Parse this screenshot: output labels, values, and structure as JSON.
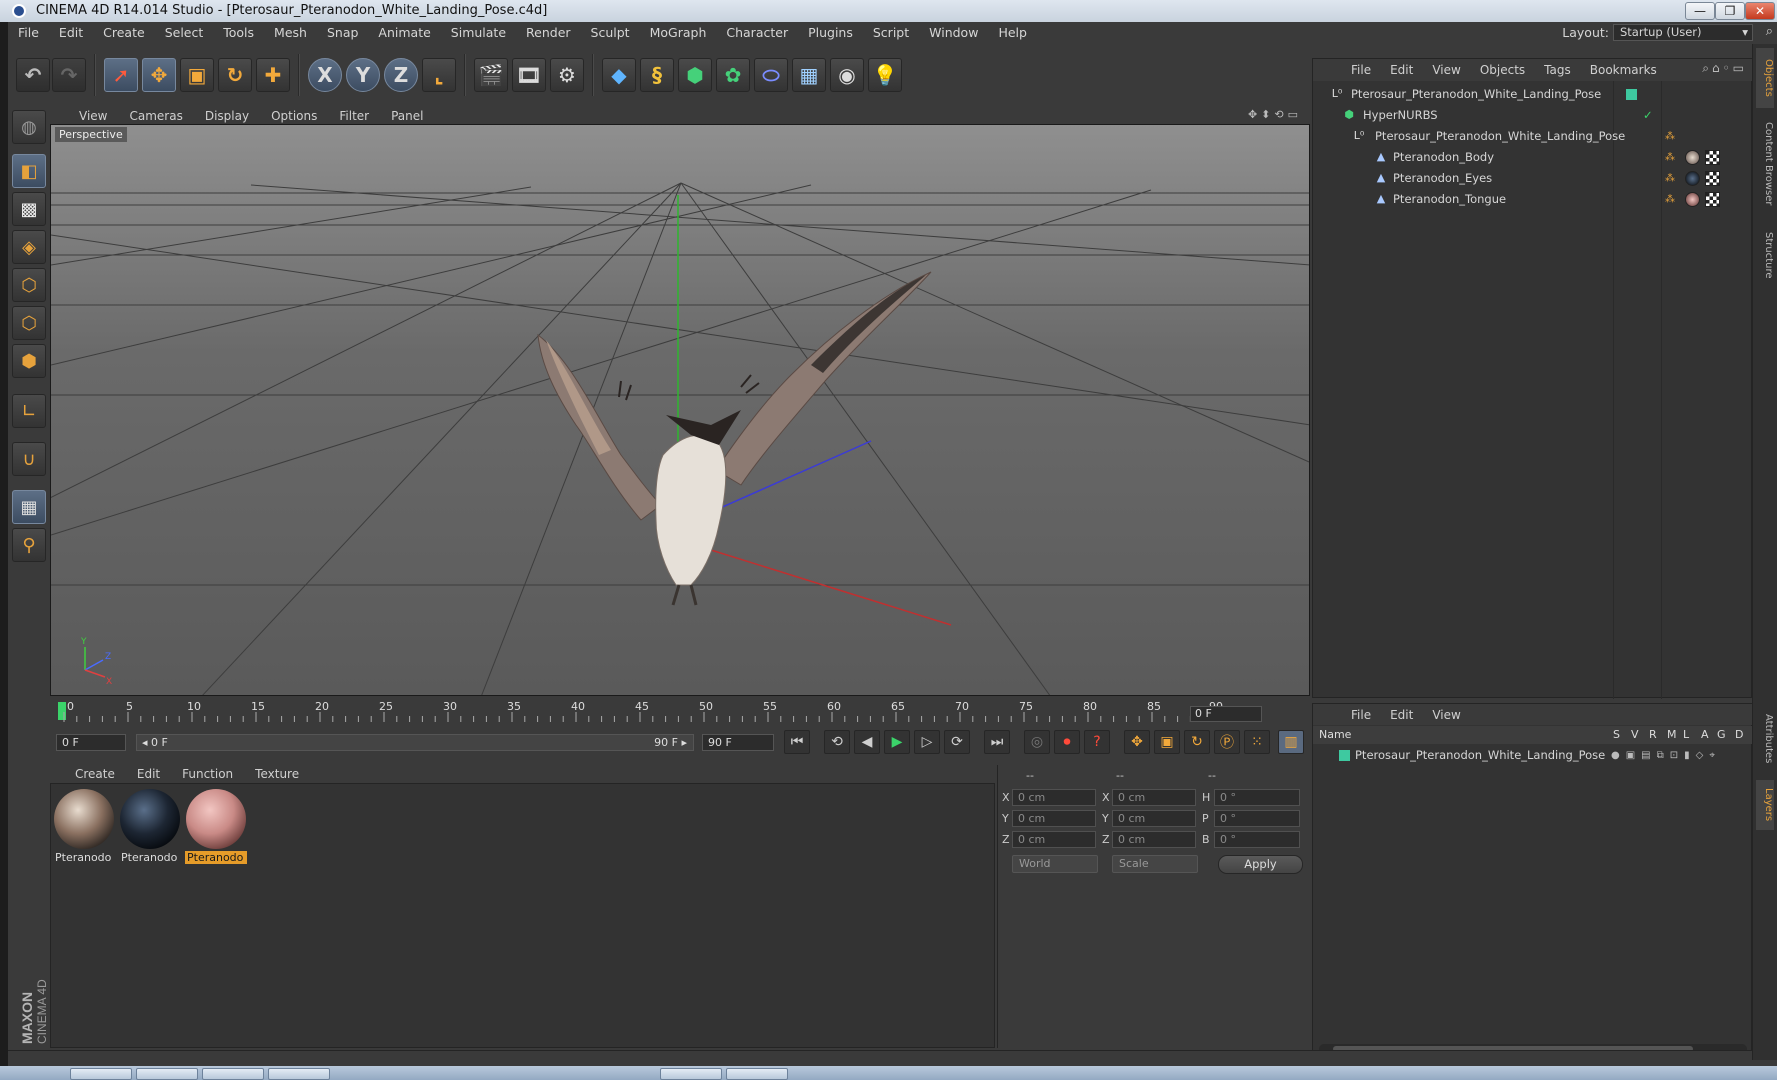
{
  "window": {
    "title": "CINEMA 4D R14.014 Studio - [Pterosaur_Pteranodon_White_Landing_Pose.c4d]",
    "controls": [
      "minimize-icon",
      "restore-icon",
      "close-icon"
    ]
  },
  "menubar": {
    "items": [
      "File",
      "Edit",
      "Create",
      "Select",
      "Tools",
      "Mesh",
      "Snap",
      "Animate",
      "Simulate",
      "Render",
      "Sculpt",
      "MoGraph",
      "Character",
      "Plugins",
      "Script",
      "Window",
      "Help"
    ],
    "layout_label": "Layout:",
    "layout_value": "Startup (User)"
  },
  "toolbar": {
    "icons": [
      "undo-icon",
      "redo-icon",
      "live-selection-icon",
      "move-icon",
      "scale-icon",
      "rotate-icon",
      "transform-icon",
      "x-axis-lock-icon",
      "y-axis-lock-icon",
      "z-axis-lock-icon",
      "coordinate-system-icon",
      "render-view-icon",
      "render-picture-viewer-icon",
      "render-settings-icon",
      "cube-primitive-icon",
      "spline-icon",
      "nurbs-icon",
      "array-icon",
      "deformer-icon",
      "floor-icon",
      "camera-icon",
      "light-icon"
    ],
    "axis_x": "X",
    "axis_y": "Y",
    "axis_z": "Z"
  },
  "left_tools": [
    "sculpt-mode-icon",
    "model-mode-icon",
    "texture-mode-icon",
    "workplane-mode-icon",
    "points-mode-icon",
    "edges-mode-icon",
    "polygons-mode-icon",
    "axis-mode-icon",
    "magnet-icon",
    "snapping-icon",
    "locked-workplane-icon"
  ],
  "brand": {
    "line1": "MAXON",
    "line2": "CINEMA 4D"
  },
  "viewport": {
    "menu": [
      "View",
      "Cameras",
      "Display",
      "Options",
      "Filter",
      "Panel"
    ],
    "label": "Perspective",
    "axes": {
      "y": "Y",
      "z": "Z",
      "x": "X"
    }
  },
  "timeline": {
    "ticks": [
      "0",
      "5",
      "10",
      "15",
      "20",
      "25",
      "30",
      "35",
      "40",
      "45",
      "50",
      "55",
      "60",
      "65",
      "70",
      "75",
      "80",
      "85",
      "90"
    ],
    "current_frame": "0 F"
  },
  "transport": {
    "start": "0 F",
    "range_start": "◂ 0 F",
    "range_end": "90 F ▸",
    "end": "90 F"
  },
  "material_manager": {
    "menu": [
      "Create",
      "Edit",
      "Function",
      "Texture"
    ],
    "materials": [
      {
        "label": "Pteranodo",
        "color": "#8a7060"
      },
      {
        "label": "Pteranodo",
        "color": "#1d2633"
      },
      {
        "label": "Pteranodo",
        "color": "#c98a86"
      }
    ]
  },
  "coordinates": {
    "headers": [
      "--",
      "--",
      "--"
    ],
    "rows": [
      {
        "a": "X",
        "av": "0 cm",
        "b": "X",
        "bv": "0 cm",
        "c": "H",
        "cv": "0 °"
      },
      {
        "a": "Y",
        "av": "0 cm",
        "b": "Y",
        "bv": "0 cm",
        "c": "P",
        "cv": "0 °"
      },
      {
        "a": "Z",
        "av": "0 cm",
        "b": "Z",
        "bv": "0 cm",
        "c": "B",
        "cv": "0 °"
      }
    ],
    "mode": "World",
    "size_mode": "Scale",
    "apply": "Apply"
  },
  "object_manager": {
    "menu": [
      "File",
      "Edit",
      "View",
      "Objects",
      "Tags",
      "Bookmarks"
    ],
    "objects": [
      {
        "name": "Pterosaur_Pteranodon_White_Landing_Pose",
        "icon": "null-object-icon",
        "indent": 0
      },
      {
        "name": "HyperNURBS",
        "icon": "hypernurbs-icon",
        "indent": 1
      },
      {
        "name": "Pterosaur_Pteranodon_White_Landing_Pose",
        "icon": "null-object-icon",
        "indent": 2
      },
      {
        "name": "Pteranodon_Body",
        "icon": "polygon-object-icon",
        "indent": 3
      },
      {
        "name": "Pteranodon_Eyes",
        "icon": "polygon-object-icon",
        "indent": 3
      },
      {
        "name": "Pteranodon_Tongue",
        "icon": "polygon-object-icon",
        "indent": 3
      }
    ]
  },
  "layer_manager": {
    "menu": [
      "File",
      "Edit",
      "View"
    ],
    "columns": [
      "Name",
      "S",
      "V",
      "R",
      "M",
      "L",
      "A",
      "G",
      "D"
    ],
    "layers": [
      {
        "name": "Pterosaur_Pteranodon_White_Landing_Pose",
        "color": "#3ec9a0"
      }
    ]
  },
  "side_tabs": [
    "Objects",
    "Content Browser",
    "Structure",
    "Attributes",
    "Layers"
  ]
}
